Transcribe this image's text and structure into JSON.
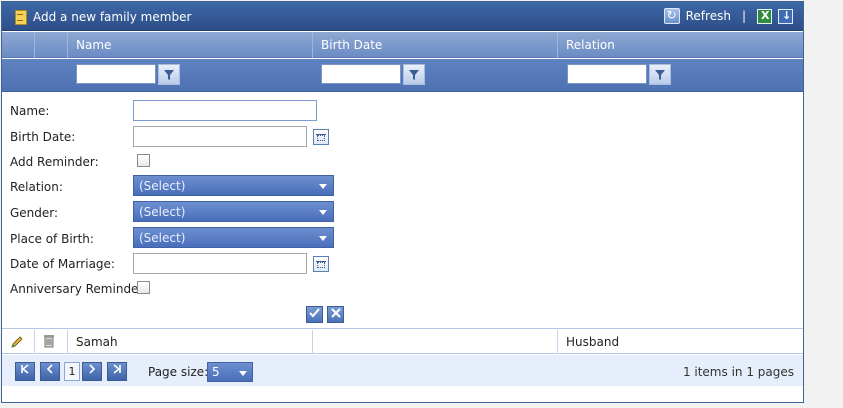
{
  "toolbar": {
    "add_label": "Add a new family member",
    "refresh_label": "Refresh",
    "separator": "|"
  },
  "columns": [
    "Name",
    "Birth Date",
    "Relation"
  ],
  "form": {
    "name_label": "Name:",
    "birth_date_label": "Birth Date:",
    "add_reminder_label": "Add Reminder:",
    "relation_label": "Relation:",
    "relation_value": "(Select)",
    "gender_label": "Gender:",
    "gender_value": "(Select)",
    "place_label": "Place of Birth:",
    "place_value": "(Select)",
    "marriage_label": "Date of Marriage:",
    "anniversary_label": "Anniversary Reminder:"
  },
  "rows": [
    {
      "name": "Samah",
      "birth_date": "",
      "relation": "Husband"
    }
  ],
  "pager": {
    "current_page": "1",
    "page_size_label": "Page size:",
    "page_size": "5",
    "info": "1 items in 1 pages"
  },
  "colors": {
    "header": "#2d4f88",
    "accent": "#4a6fba",
    "pager_bg": "#e6eefb"
  }
}
